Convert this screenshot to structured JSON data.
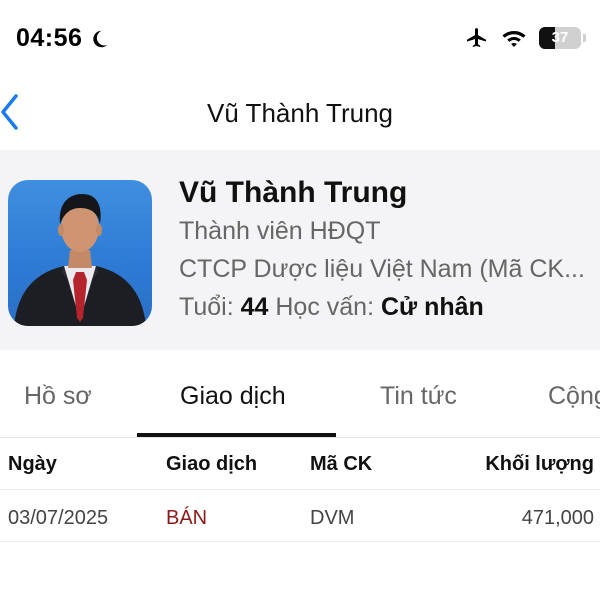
{
  "status_bar": {
    "time": "04:56",
    "battery": "37",
    "battery_level": 0.37,
    "icons": [
      "moon-icon",
      "airplane-icon",
      "wifi-icon",
      "battery-icon"
    ]
  },
  "nav": {
    "title": "Vũ Thành Trung",
    "back_icon": "chevron-left-icon",
    "accent": "#1a7cf0"
  },
  "profile": {
    "name": "Vũ Thành Trung",
    "position": "Thành viên HĐQT",
    "company": "CTCP Dược liệu Việt Nam (Mã CK...",
    "age_label": "Tuổi:",
    "age_value": "44",
    "education_label": "Học vấn:",
    "education_value": "Cử nhân"
  },
  "tabs": [
    {
      "label": "Hồ sơ",
      "active": false
    },
    {
      "label": "Giao dịch",
      "active": true
    },
    {
      "label": "Tin tức",
      "active": false
    },
    {
      "label": "Cộng",
      "active": false
    }
  ],
  "table": {
    "columns": [
      "Ngày",
      "Giao dịch",
      "Mã CK",
      "Khối lượng"
    ],
    "rows": [
      {
        "date": "03/07/2025",
        "type": "BÁN",
        "ticker": "DVM",
        "volume": "471,000"
      }
    ],
    "sell_color": "#8b1a1a"
  }
}
